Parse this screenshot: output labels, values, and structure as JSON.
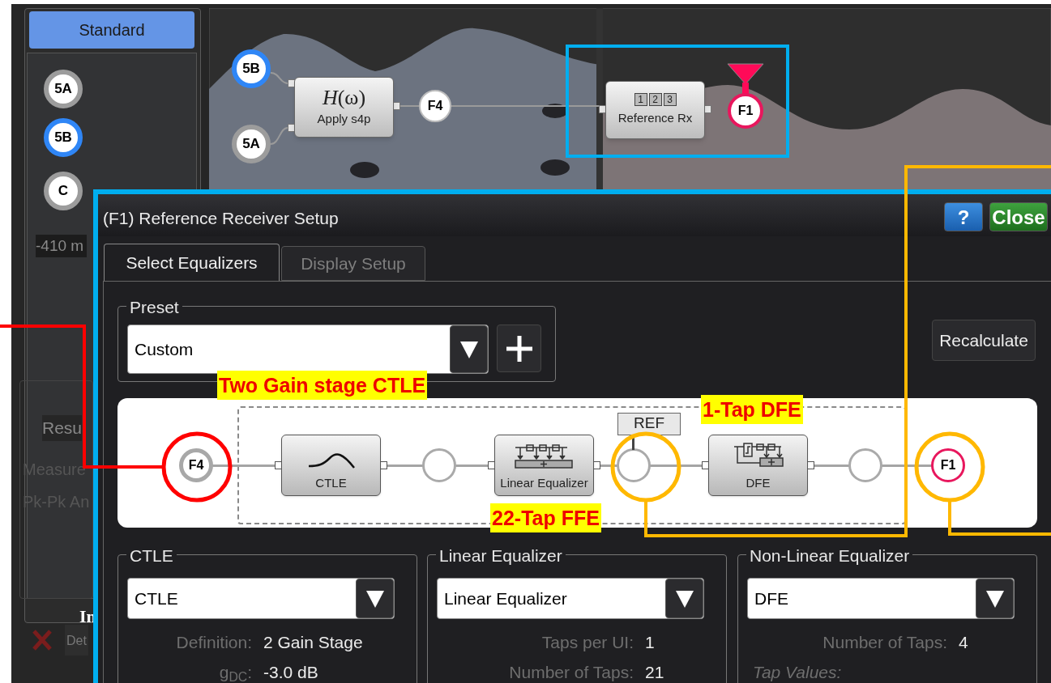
{
  "sidebar": {
    "mode_button": "Standard",
    "channels": [
      {
        "label": "5A",
        "color": "#9c9c9c"
      },
      {
        "label": "5B",
        "color": "#2f86f6"
      },
      {
        "label": "C",
        "color": "#9c9c9c"
      }
    ]
  },
  "behind_dialog": [
    {
      "kind": "readout",
      "text": "-410 m"
    },
    {
      "kind": "tab",
      "text": "Resu"
    },
    {
      "kind": "header",
      "text": "Measure"
    },
    {
      "kind": "row",
      "text": "Pk-Pk An"
    },
    {
      "kind": "caption",
      "text": "In"
    },
    {
      "kind": "button",
      "text": "Det"
    }
  ],
  "flow": [
    {
      "kind": "source",
      "label": "5B",
      "color": "#2f86f6"
    },
    {
      "kind": "source",
      "label": "5A",
      "color": "#9c9c9c"
    },
    {
      "kind": "s4p",
      "formula": "*H*(ω)",
      "label": "Apply s4p"
    },
    {
      "kind": "function",
      "label": "F4",
      "color": "#bdbdbd"
    },
    {
      "kind": "receiver",
      "taps": [
        "1",
        "2",
        "3"
      ],
      "label": "Reference Rx"
    },
    {
      "kind": "output",
      "label": "F1",
      "color": "#e8175d"
    }
  ],
  "dialog": {
    "title": "(F1) Reference Receiver Setup",
    "help_button": "?",
    "close_button": "Close",
    "tabs": [
      {
        "label": "Select Equalizers",
        "selected": true
      },
      {
        "label": "Display Setup",
        "selected": false
      }
    ],
    "preset": {
      "legend": "Preset",
      "value": "Custom"
    },
    "recalculate_button": "Recalculate",
    "chain": [
      {
        "kind": "input",
        "label": "F4"
      },
      {
        "kind": "ctle",
        "label": "CTLE"
      },
      {
        "kind": "junction"
      },
      {
        "kind": "ffe",
        "label": "Linear Equalizer"
      },
      {
        "kind": "junction",
        "tag": "REF"
      },
      {
        "kind": "dfe",
        "label": "DFE"
      },
      {
        "kind": "junction"
      },
      {
        "kind": "output",
        "label": "F1"
      }
    ],
    "groups": [
      {
        "legend": "CTLE",
        "value": "CTLE",
        "fields": [
          {
            "label": "Definition:",
            "value": "2 Gain Stage"
          },
          {
            "label": "g$_{DC}$:",
            "value": "-3.0 dB"
          }
        ]
      },
      {
        "legend": "Linear Equalizer",
        "value": "Linear Equalizer",
        "fields": [
          {
            "label": "Taps per UI:",
            "value": "1"
          },
          {
            "label": "Number of Taps:",
            "value": "21"
          }
        ]
      },
      {
        "legend": "Non-Linear Equalizer",
        "value": "DFE",
        "fields": [
          {
            "label": "Number of Taps:",
            "value": "4"
          }
        ],
        "note": "Tap Values:"
      }
    ]
  },
  "annotations": [
    {
      "text": "Two Gain stage CTLE"
    },
    {
      "text": "1-Tap DFE"
    },
    {
      "text": "22-Tap FFE"
    }
  ]
}
